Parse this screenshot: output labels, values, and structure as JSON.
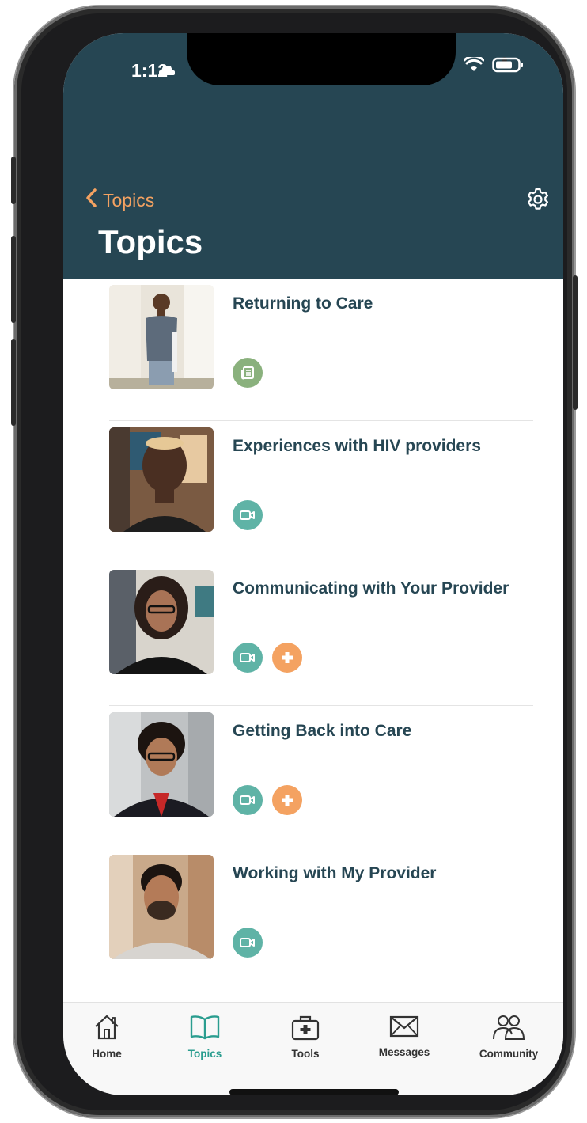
{
  "status_bar": {
    "time": "1:12"
  },
  "nav": {
    "back_label": "Topics",
    "title": "Topics"
  },
  "colors": {
    "header": "#264653",
    "accent": "#f4a261",
    "teal": "#2a9d8f",
    "text": "#264653"
  },
  "topics": [
    {
      "title": "Returning to Care",
      "badges": [
        "article-icon"
      ]
    },
    {
      "title": "Experiences with HIV providers",
      "badges": [
        "video-icon"
      ]
    },
    {
      "title": "Communicating with Your Provider",
      "badges": [
        "video-icon",
        "plus-icon"
      ]
    },
    {
      "title": "Getting Back into Care",
      "badges": [
        "video-icon",
        "plus-icon"
      ]
    },
    {
      "title": "Working with My Provider",
      "badges": [
        "video-icon"
      ]
    }
  ],
  "tabbar": {
    "home": "Home",
    "topics": "Topics",
    "tools": "Tools",
    "messages": "Messages",
    "community": "Community",
    "active": "Topics"
  }
}
